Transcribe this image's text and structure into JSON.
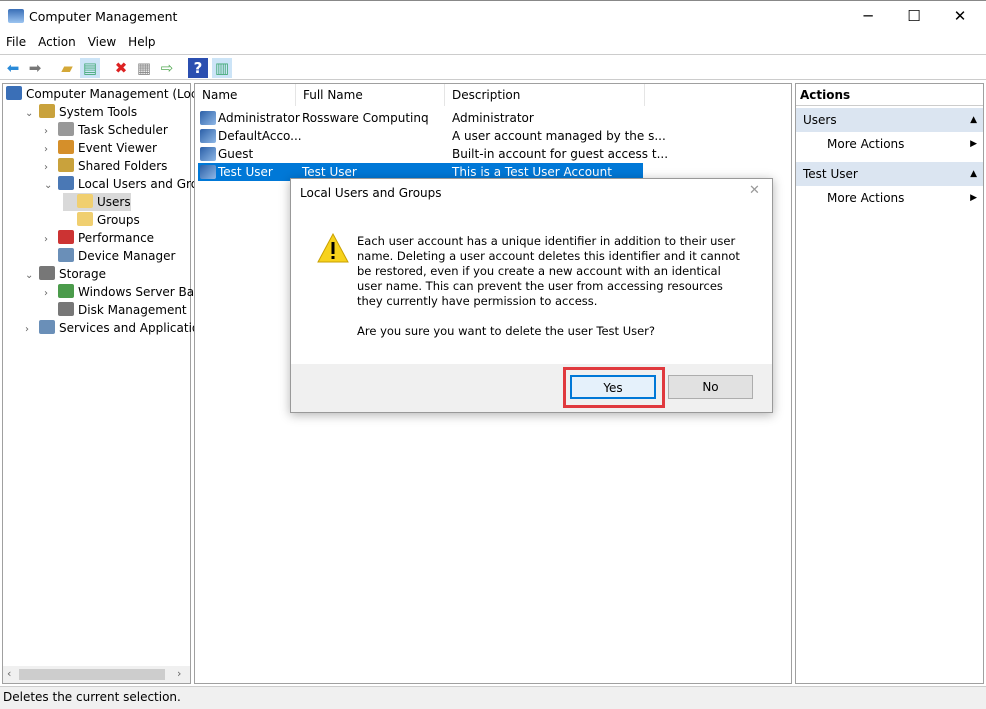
{
  "window": {
    "title": "Computer Management",
    "minimize": "─",
    "maximize": "☐",
    "close": "✕"
  },
  "menu": [
    "File",
    "Action",
    "View",
    "Help"
  ],
  "tree": [
    {
      "label": "Computer Management (Local",
      "level": 0,
      "chev": ""
    },
    {
      "label": "System Tools",
      "level": 1,
      "chev": "⌄"
    },
    {
      "label": "Task Scheduler",
      "level": 2,
      "chev": "›"
    },
    {
      "label": "Event Viewer",
      "level": 2,
      "chev": "›"
    },
    {
      "label": "Shared Folders",
      "level": 2,
      "chev": "›"
    },
    {
      "label": "Local Users and Groups",
      "level": 2,
      "chev": "⌄"
    },
    {
      "label": "Users",
      "level": 3,
      "chev": "",
      "selected": true
    },
    {
      "label": "Groups",
      "level": 3,
      "chev": ""
    },
    {
      "label": "Performance",
      "level": 2,
      "chev": "›"
    },
    {
      "label": "Device Manager",
      "level": 2,
      "chev": ""
    },
    {
      "label": "Storage",
      "level": 1,
      "chev": "⌄"
    },
    {
      "label": "Windows Server Backup",
      "level": 2,
      "chev": "›"
    },
    {
      "label": "Disk Management",
      "level": 2,
      "chev": ""
    },
    {
      "label": "Services and Applications",
      "level": 1,
      "chev": "›"
    }
  ],
  "list": {
    "columns": [
      "Name",
      "Full Name",
      "Description"
    ],
    "rows": [
      {
        "name": "Administrator",
        "full": "Rossware Computinq",
        "desc": "Administrator"
      },
      {
        "name": "DefaultAcco...",
        "full": "",
        "desc": "A user account managed by the s..."
      },
      {
        "name": "Guest",
        "full": "",
        "desc": "Built-in account for guest access t..."
      },
      {
        "name": "Test User",
        "full": "Test User",
        "desc": "This is a Test User Account",
        "selected": true
      }
    ]
  },
  "actions": {
    "header": "Actions",
    "sections": [
      {
        "title": "Users",
        "item": "More Actions"
      },
      {
        "title": "Test User",
        "item": "More Actions"
      }
    ]
  },
  "dialog": {
    "title": "Local Users and Groups",
    "message": "Each user account has a unique identifier in addition to their user name. Deleting a user account deletes this identifier and it cannot be restored, even if you create a new account with an identical user name. This can prevent the user from accessing resources they currently have permission to access.",
    "question": "Are you sure you want to delete the user Test User?",
    "yes": "Yes",
    "no": "No",
    "close": "✕"
  },
  "status": "Deletes the current selection.",
  "colors": {
    "selection": "#0078d7",
    "highlight": "#e0393e"
  }
}
